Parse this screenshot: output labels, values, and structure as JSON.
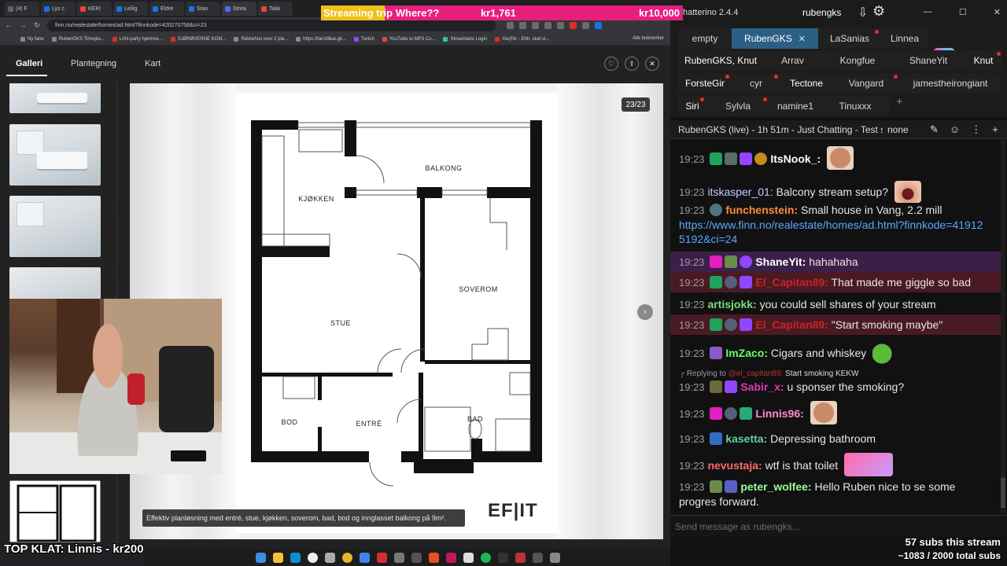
{
  "browser": {
    "tabs": [
      {
        "label": "(4) F",
        "color": "#5f6368"
      },
      {
        "label": "Lys c",
        "color": "#1a73e8"
      },
      {
        "label": "KEKI",
        "color": "#ea4335"
      },
      {
        "label": "Leilig",
        "color": "#1a73e8"
      },
      {
        "label": "Eldre",
        "color": "#1a73e8"
      },
      {
        "label": "Stan",
        "color": "#1a73e8"
      },
      {
        "label": "Strea",
        "color": "#5865f2"
      },
      {
        "label": "Takk",
        "color": "#e8453c"
      }
    ],
    "url": "finn.no/realestate/homes/ad.html?finnkode=420270758&ci=23",
    "bookmarks": [
      "Ny fane",
      "RubenGKS Timepla...",
      "LAN-party hjemme...",
      "SJØRØVERNE KOM...",
      "Rekkehus over 2 pla...",
      "https://fan1tilkai.git...",
      "Twitch",
      "YouTube to MP3 Co...",
      "Streamlabs Login",
      "XeqTer - Ehh, skal vi..."
    ],
    "bookmarks_right": "Alle bokmerker"
  },
  "gallery": {
    "tabs": [
      "Galleri",
      "Plantegning",
      "Kart"
    ],
    "counter": "23/23",
    "next": "›",
    "icons": {
      "heart": "♡",
      "share": "⇪",
      "close": "✕"
    },
    "caption": "Effektiv planløsning med entré, stue, kjøkken, soverom, bad, bod og innglasset balkong på 9m².",
    "logo": "EF|IT",
    "rooms": {
      "balkong": "BALKONG",
      "kjokken": "KJØKKEN",
      "soverom": "SOVEROM",
      "stue": "STUE",
      "bod": "BOD",
      "entre": "ENTRÉ",
      "bad": "BAD"
    }
  },
  "overlay": {
    "top_klat": "TOP KLAT: Linnis - kr200",
    "banner_label": "Streaming trip Where??",
    "banner_current": "kr1,761",
    "banner_goal": "kr10,000",
    "banner_progress": 0.176,
    "subs_line1": "57 subs this stream",
    "subs_line2": "~1083 / 2000 total subs"
  },
  "chat": {
    "app_title": "hatterino 2.4.4",
    "username": "rubengks",
    "tabs_row1": [
      "empty",
      "RubenGKS",
      "LaSanias",
      "Linnea"
    ],
    "tabs_row2": [
      "RubenGKS, Knut",
      "Arrav",
      "Kongfue",
      "ShaneYit",
      "Knut"
    ],
    "tabs_row3": [
      "ForsteGir",
      "cyr",
      "Tectone",
      "Vangard",
      "jamestheirongiant"
    ],
    "tabs_row4": [
      "Siri",
      "Sylvla",
      "namine1",
      "Tinuxxx"
    ],
    "channel_title": "RubenGKS (live) - 1h 51m - Just Chatting - Test stre",
    "channel_mode": "none",
    "input_placeholder": "Send message as rubengks...",
    "messages": [
      {
        "time": "19:23",
        "user": "ItsNook_:",
        "text": "",
        "color": "#ffffff"
      },
      {
        "time": "19:23",
        "user": "itskasper_01:",
        "text": " Balcony stream setup?",
        "color": "#c8c8ff"
      },
      {
        "time": "19:23",
        "user": "funchenstein:",
        "text": " Small house in Vang, 2.2 mill",
        "color": "#ff8a3a"
      },
      {
        "time": "19:23",
        "user": "ShaneYit:",
        "text": " hahahaha",
        "color": "#ffffff"
      },
      {
        "time": "19:23",
        "user": "El_Capitan89:",
        "text": " That made me giggle so bad",
        "color": "#cc2222"
      },
      {
        "time": "19:23",
        "user": "artisjokk:",
        "text": " you could sell shares of your stream",
        "color": "#7fdc7f"
      },
      {
        "time": "19:23",
        "user": "El_Capitan89:",
        "text": " \"Start smoking maybe\"",
        "color": "#cc2222"
      },
      {
        "time": "19:23",
        "user": "ImZaco:",
        "text": " Cigars and whiskey",
        "color": "#66ff66"
      },
      {
        "time": "19:23",
        "user": "Sabir_x:",
        "text": " u sponser the smoking?",
        "color": "#dd3ab4"
      },
      {
        "time": "19:23",
        "user": "Linnis96:",
        "text": "",
        "color": "#ff8ad8"
      },
      {
        "time": "19:23",
        "user": "kasetta:",
        "text": " Depressing bathroom",
        "color": "#5fd0a4"
      },
      {
        "time": "19:23",
        "user": "nevustaja:",
        "text": " wtf is that toilet",
        "color": "#ff6a6a"
      },
      {
        "time": "19:23",
        "user": "peter_wolfee:",
        "text": " Hello Ruben nice to se some",
        "color": "#9aff9a"
      }
    ],
    "link_line1": "https://www.finn.no/realestate/homes/ad.html?finnkode=41912",
    "link_line2": "5192&ci=24",
    "reply_prefix": "Replying to",
    "reply_user": "@el_capitan89:",
    "reply_text": " Start smoking KEKW",
    "cont_line": "progres forward."
  }
}
